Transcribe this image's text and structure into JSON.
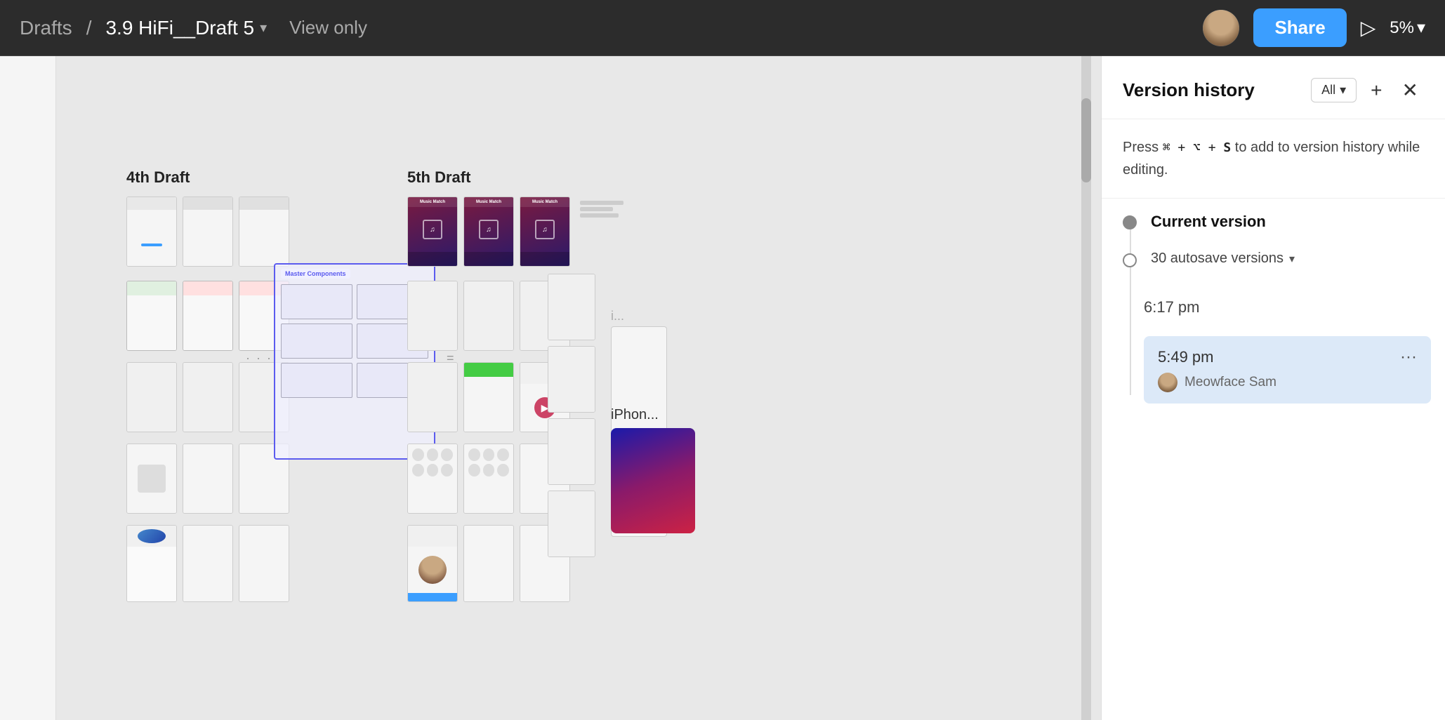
{
  "topbar": {
    "breadcrumb_parent": "Drafts",
    "breadcrumb_separator": "/",
    "breadcrumb_current": "3.9 HiFi__Draft 5",
    "chevron": "▾",
    "view_only": "View only",
    "share_label": "Share",
    "play_icon": "▷",
    "zoom_label": "5%",
    "zoom_chevron": "▾"
  },
  "panel": {
    "title": "Version history",
    "filter_label": "All",
    "filter_chevron": "▾",
    "add_icon": "+",
    "close_icon": "✕",
    "hint_text_before": "Press",
    "hint_shortcut": "⌘ + ⌥ + S",
    "hint_text_after": "to add to version history while editing.",
    "hint_s_bold": "S",
    "current_version_label": "Current version",
    "autosave_label": "30 autosave versions",
    "autosave_chevron": "▾",
    "time_1": "6:17 pm",
    "selected_time": "5:49 pm",
    "selected_author": "Meowface Sam",
    "more_icon": "···"
  },
  "canvas": {
    "draft4_label": "4th Draft",
    "draft5_label": "5th Draft",
    "iphone_label": "iPhon..."
  }
}
